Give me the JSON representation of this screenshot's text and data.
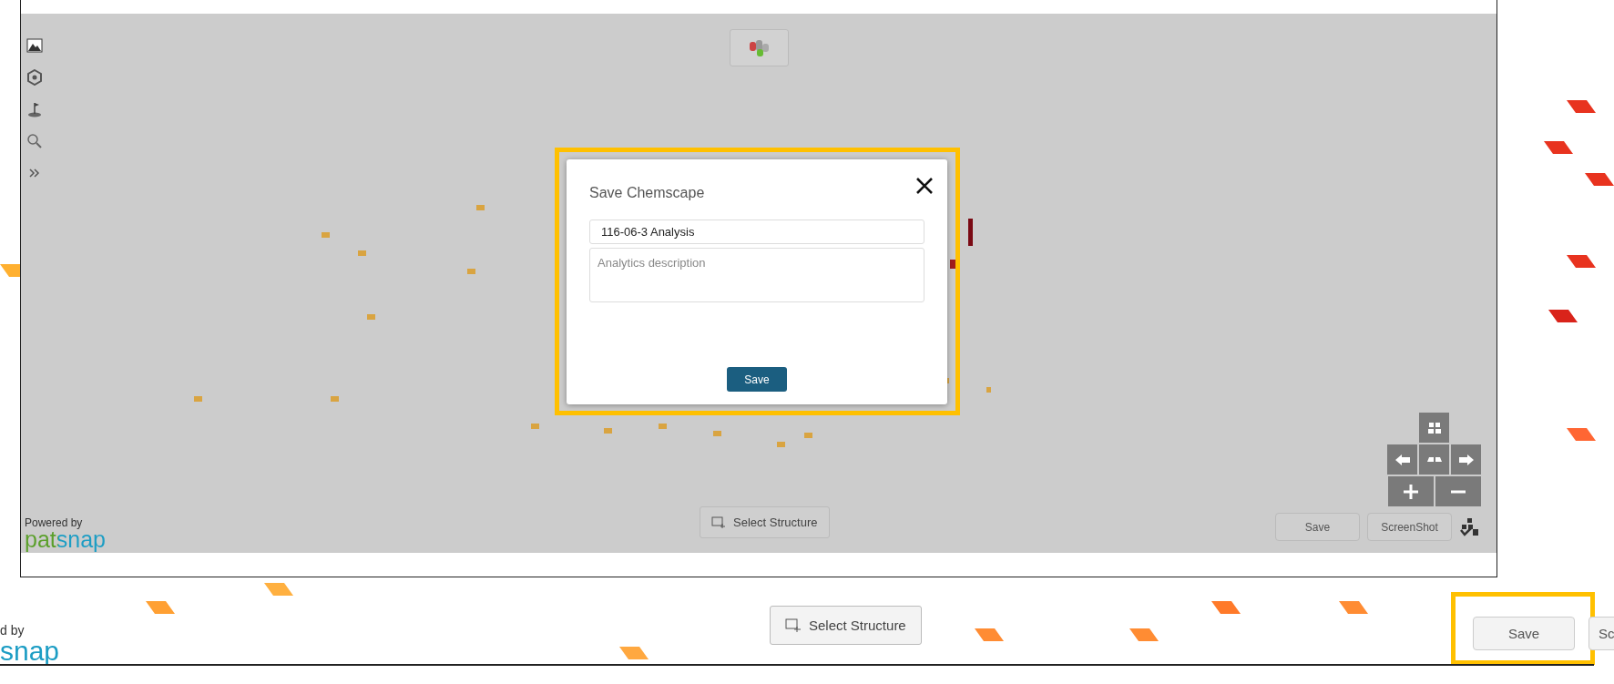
{
  "outer_page": {
    "powered_by": "d by",
    "logo": "snap",
    "select_button": "Select Structure",
    "save_button": {
      "label": "Save",
      "highlighted": true
    },
    "cut_button": "Sc"
  },
  "app_window": {
    "left_tools": [
      {
        "kind": "landscape"
      },
      {
        "kind": "hexagon"
      },
      {
        "kind": "flag"
      },
      {
        "kind": "search"
      },
      {
        "kind": "chevrons"
      }
    ],
    "powered_by": "Powered by",
    "logo": "patsnap",
    "select_button": "Select Structure",
    "bottom_buttons": [
      "Save",
      "ScreenShot"
    ],
    "nav_pad": [
      {
        "kind": "grid"
      },
      {
        "kind": "left"
      },
      {
        "kind": "center"
      },
      {
        "kind": "right"
      },
      {
        "kind": "plus"
      },
      {
        "kind": "minus"
      }
    ]
  },
  "dialog": {
    "title": "Save Chemscape",
    "name_value": "116-06-3 Analysis",
    "description_placeholder": "Analytics description",
    "save_button": "Save",
    "highlighted": true
  }
}
